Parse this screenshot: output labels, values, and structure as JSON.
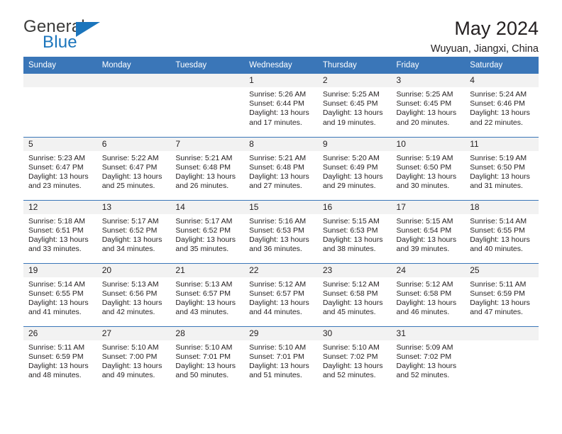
{
  "brand": {
    "name_primary": "General",
    "name_secondary": "Blue",
    "triangle_icon": "triangle-icon",
    "color_primary": "#3c3c3b",
    "color_secondary": "#1b75bc"
  },
  "header": {
    "title": "May 2024",
    "subtitle": "Wuyuan, Jiangxi, China"
  },
  "theme": {
    "header_blue": "#3a76b8",
    "daynum_band": "#f2f2f2",
    "text": "#231f20"
  },
  "weekday_headers": [
    "Sunday",
    "Monday",
    "Tuesday",
    "Wednesday",
    "Thursday",
    "Friday",
    "Saturday"
  ],
  "weeks": [
    [
      {
        "empty": true
      },
      {
        "empty": true
      },
      {
        "empty": true
      },
      {
        "day": "1",
        "sunrise": "Sunrise: 5:26 AM",
        "sunset": "Sunset: 6:44 PM",
        "daylight_1": "Daylight: 13 hours",
        "daylight_2": "and 17 minutes."
      },
      {
        "day": "2",
        "sunrise": "Sunrise: 5:25 AM",
        "sunset": "Sunset: 6:45 PM",
        "daylight_1": "Daylight: 13 hours",
        "daylight_2": "and 19 minutes."
      },
      {
        "day": "3",
        "sunrise": "Sunrise: 5:25 AM",
        "sunset": "Sunset: 6:45 PM",
        "daylight_1": "Daylight: 13 hours",
        "daylight_2": "and 20 minutes."
      },
      {
        "day": "4",
        "sunrise": "Sunrise: 5:24 AM",
        "sunset": "Sunset: 6:46 PM",
        "daylight_1": "Daylight: 13 hours",
        "daylight_2": "and 22 minutes."
      }
    ],
    [
      {
        "day": "5",
        "sunrise": "Sunrise: 5:23 AM",
        "sunset": "Sunset: 6:47 PM",
        "daylight_1": "Daylight: 13 hours",
        "daylight_2": "and 23 minutes."
      },
      {
        "day": "6",
        "sunrise": "Sunrise: 5:22 AM",
        "sunset": "Sunset: 6:47 PM",
        "daylight_1": "Daylight: 13 hours",
        "daylight_2": "and 25 minutes."
      },
      {
        "day": "7",
        "sunrise": "Sunrise: 5:21 AM",
        "sunset": "Sunset: 6:48 PM",
        "daylight_1": "Daylight: 13 hours",
        "daylight_2": "and 26 minutes."
      },
      {
        "day": "8",
        "sunrise": "Sunrise: 5:21 AM",
        "sunset": "Sunset: 6:48 PM",
        "daylight_1": "Daylight: 13 hours",
        "daylight_2": "and 27 minutes."
      },
      {
        "day": "9",
        "sunrise": "Sunrise: 5:20 AM",
        "sunset": "Sunset: 6:49 PM",
        "daylight_1": "Daylight: 13 hours",
        "daylight_2": "and 29 minutes."
      },
      {
        "day": "10",
        "sunrise": "Sunrise: 5:19 AM",
        "sunset": "Sunset: 6:50 PM",
        "daylight_1": "Daylight: 13 hours",
        "daylight_2": "and 30 minutes."
      },
      {
        "day": "11",
        "sunrise": "Sunrise: 5:19 AM",
        "sunset": "Sunset: 6:50 PM",
        "daylight_1": "Daylight: 13 hours",
        "daylight_2": "and 31 minutes."
      }
    ],
    [
      {
        "day": "12",
        "sunrise": "Sunrise: 5:18 AM",
        "sunset": "Sunset: 6:51 PM",
        "daylight_1": "Daylight: 13 hours",
        "daylight_2": "and 33 minutes."
      },
      {
        "day": "13",
        "sunrise": "Sunrise: 5:17 AM",
        "sunset": "Sunset: 6:52 PM",
        "daylight_1": "Daylight: 13 hours",
        "daylight_2": "and 34 minutes."
      },
      {
        "day": "14",
        "sunrise": "Sunrise: 5:17 AM",
        "sunset": "Sunset: 6:52 PM",
        "daylight_1": "Daylight: 13 hours",
        "daylight_2": "and 35 minutes."
      },
      {
        "day": "15",
        "sunrise": "Sunrise: 5:16 AM",
        "sunset": "Sunset: 6:53 PM",
        "daylight_1": "Daylight: 13 hours",
        "daylight_2": "and 36 minutes."
      },
      {
        "day": "16",
        "sunrise": "Sunrise: 5:15 AM",
        "sunset": "Sunset: 6:53 PM",
        "daylight_1": "Daylight: 13 hours",
        "daylight_2": "and 38 minutes."
      },
      {
        "day": "17",
        "sunrise": "Sunrise: 5:15 AM",
        "sunset": "Sunset: 6:54 PM",
        "daylight_1": "Daylight: 13 hours",
        "daylight_2": "and 39 minutes."
      },
      {
        "day": "18",
        "sunrise": "Sunrise: 5:14 AM",
        "sunset": "Sunset: 6:55 PM",
        "daylight_1": "Daylight: 13 hours",
        "daylight_2": "and 40 minutes."
      }
    ],
    [
      {
        "day": "19",
        "sunrise": "Sunrise: 5:14 AM",
        "sunset": "Sunset: 6:55 PM",
        "daylight_1": "Daylight: 13 hours",
        "daylight_2": "and 41 minutes."
      },
      {
        "day": "20",
        "sunrise": "Sunrise: 5:13 AM",
        "sunset": "Sunset: 6:56 PM",
        "daylight_1": "Daylight: 13 hours",
        "daylight_2": "and 42 minutes."
      },
      {
        "day": "21",
        "sunrise": "Sunrise: 5:13 AM",
        "sunset": "Sunset: 6:57 PM",
        "daylight_1": "Daylight: 13 hours",
        "daylight_2": "and 43 minutes."
      },
      {
        "day": "22",
        "sunrise": "Sunrise: 5:12 AM",
        "sunset": "Sunset: 6:57 PM",
        "daylight_1": "Daylight: 13 hours",
        "daylight_2": "and 44 minutes."
      },
      {
        "day": "23",
        "sunrise": "Sunrise: 5:12 AM",
        "sunset": "Sunset: 6:58 PM",
        "daylight_1": "Daylight: 13 hours",
        "daylight_2": "and 45 minutes."
      },
      {
        "day": "24",
        "sunrise": "Sunrise: 5:12 AM",
        "sunset": "Sunset: 6:58 PM",
        "daylight_1": "Daylight: 13 hours",
        "daylight_2": "and 46 minutes."
      },
      {
        "day": "25",
        "sunrise": "Sunrise: 5:11 AM",
        "sunset": "Sunset: 6:59 PM",
        "daylight_1": "Daylight: 13 hours",
        "daylight_2": "and 47 minutes."
      }
    ],
    [
      {
        "day": "26",
        "sunrise": "Sunrise: 5:11 AM",
        "sunset": "Sunset: 6:59 PM",
        "daylight_1": "Daylight: 13 hours",
        "daylight_2": "and 48 minutes."
      },
      {
        "day": "27",
        "sunrise": "Sunrise: 5:10 AM",
        "sunset": "Sunset: 7:00 PM",
        "daylight_1": "Daylight: 13 hours",
        "daylight_2": "and 49 minutes."
      },
      {
        "day": "28",
        "sunrise": "Sunrise: 5:10 AM",
        "sunset": "Sunset: 7:01 PM",
        "daylight_1": "Daylight: 13 hours",
        "daylight_2": "and 50 minutes."
      },
      {
        "day": "29",
        "sunrise": "Sunrise: 5:10 AM",
        "sunset": "Sunset: 7:01 PM",
        "daylight_1": "Daylight: 13 hours",
        "daylight_2": "and 51 minutes."
      },
      {
        "day": "30",
        "sunrise": "Sunrise: 5:10 AM",
        "sunset": "Sunset: 7:02 PM",
        "daylight_1": "Daylight: 13 hours",
        "daylight_2": "and 52 minutes."
      },
      {
        "day": "31",
        "sunrise": "Sunrise: 5:09 AM",
        "sunset": "Sunset: 7:02 PM",
        "daylight_1": "Daylight: 13 hours",
        "daylight_2": "and 52 minutes."
      },
      {
        "empty": true
      }
    ]
  ]
}
